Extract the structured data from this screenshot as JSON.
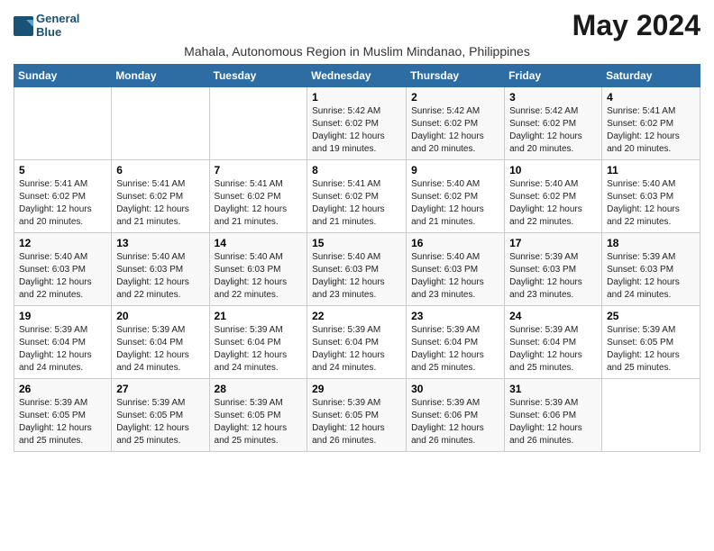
{
  "logo": {
    "line1": "General",
    "line2": "Blue"
  },
  "title": "May 2024",
  "subtitle": "Mahala, Autonomous Region in Muslim Mindanao, Philippines",
  "days_of_week": [
    "Sunday",
    "Monday",
    "Tuesday",
    "Wednesday",
    "Thursday",
    "Friday",
    "Saturday"
  ],
  "weeks": [
    [
      {
        "num": "",
        "info": ""
      },
      {
        "num": "",
        "info": ""
      },
      {
        "num": "",
        "info": ""
      },
      {
        "num": "1",
        "info": "Sunrise: 5:42 AM\nSunset: 6:02 PM\nDaylight: 12 hours\nand 19 minutes."
      },
      {
        "num": "2",
        "info": "Sunrise: 5:42 AM\nSunset: 6:02 PM\nDaylight: 12 hours\nand 20 minutes."
      },
      {
        "num": "3",
        "info": "Sunrise: 5:42 AM\nSunset: 6:02 PM\nDaylight: 12 hours\nand 20 minutes."
      },
      {
        "num": "4",
        "info": "Sunrise: 5:41 AM\nSunset: 6:02 PM\nDaylight: 12 hours\nand 20 minutes."
      }
    ],
    [
      {
        "num": "5",
        "info": "Sunrise: 5:41 AM\nSunset: 6:02 PM\nDaylight: 12 hours\nand 20 minutes."
      },
      {
        "num": "6",
        "info": "Sunrise: 5:41 AM\nSunset: 6:02 PM\nDaylight: 12 hours\nand 21 minutes."
      },
      {
        "num": "7",
        "info": "Sunrise: 5:41 AM\nSunset: 6:02 PM\nDaylight: 12 hours\nand 21 minutes."
      },
      {
        "num": "8",
        "info": "Sunrise: 5:41 AM\nSunset: 6:02 PM\nDaylight: 12 hours\nand 21 minutes."
      },
      {
        "num": "9",
        "info": "Sunrise: 5:40 AM\nSunset: 6:02 PM\nDaylight: 12 hours\nand 21 minutes."
      },
      {
        "num": "10",
        "info": "Sunrise: 5:40 AM\nSunset: 6:02 PM\nDaylight: 12 hours\nand 22 minutes."
      },
      {
        "num": "11",
        "info": "Sunrise: 5:40 AM\nSunset: 6:03 PM\nDaylight: 12 hours\nand 22 minutes."
      }
    ],
    [
      {
        "num": "12",
        "info": "Sunrise: 5:40 AM\nSunset: 6:03 PM\nDaylight: 12 hours\nand 22 minutes."
      },
      {
        "num": "13",
        "info": "Sunrise: 5:40 AM\nSunset: 6:03 PM\nDaylight: 12 hours\nand 22 minutes."
      },
      {
        "num": "14",
        "info": "Sunrise: 5:40 AM\nSunset: 6:03 PM\nDaylight: 12 hours\nand 22 minutes."
      },
      {
        "num": "15",
        "info": "Sunrise: 5:40 AM\nSunset: 6:03 PM\nDaylight: 12 hours\nand 23 minutes."
      },
      {
        "num": "16",
        "info": "Sunrise: 5:40 AM\nSunset: 6:03 PM\nDaylight: 12 hours\nand 23 minutes."
      },
      {
        "num": "17",
        "info": "Sunrise: 5:39 AM\nSunset: 6:03 PM\nDaylight: 12 hours\nand 23 minutes."
      },
      {
        "num": "18",
        "info": "Sunrise: 5:39 AM\nSunset: 6:03 PM\nDaylight: 12 hours\nand 24 minutes."
      }
    ],
    [
      {
        "num": "19",
        "info": "Sunrise: 5:39 AM\nSunset: 6:04 PM\nDaylight: 12 hours\nand 24 minutes."
      },
      {
        "num": "20",
        "info": "Sunrise: 5:39 AM\nSunset: 6:04 PM\nDaylight: 12 hours\nand 24 minutes."
      },
      {
        "num": "21",
        "info": "Sunrise: 5:39 AM\nSunset: 6:04 PM\nDaylight: 12 hours\nand 24 minutes."
      },
      {
        "num": "22",
        "info": "Sunrise: 5:39 AM\nSunset: 6:04 PM\nDaylight: 12 hours\nand 24 minutes."
      },
      {
        "num": "23",
        "info": "Sunrise: 5:39 AM\nSunset: 6:04 PM\nDaylight: 12 hours\nand 25 minutes."
      },
      {
        "num": "24",
        "info": "Sunrise: 5:39 AM\nSunset: 6:04 PM\nDaylight: 12 hours\nand 25 minutes."
      },
      {
        "num": "25",
        "info": "Sunrise: 5:39 AM\nSunset: 6:05 PM\nDaylight: 12 hours\nand 25 minutes."
      }
    ],
    [
      {
        "num": "26",
        "info": "Sunrise: 5:39 AM\nSunset: 6:05 PM\nDaylight: 12 hours\nand 25 minutes."
      },
      {
        "num": "27",
        "info": "Sunrise: 5:39 AM\nSunset: 6:05 PM\nDaylight: 12 hours\nand 25 minutes."
      },
      {
        "num": "28",
        "info": "Sunrise: 5:39 AM\nSunset: 6:05 PM\nDaylight: 12 hours\nand 25 minutes."
      },
      {
        "num": "29",
        "info": "Sunrise: 5:39 AM\nSunset: 6:05 PM\nDaylight: 12 hours\nand 26 minutes."
      },
      {
        "num": "30",
        "info": "Sunrise: 5:39 AM\nSunset: 6:06 PM\nDaylight: 12 hours\nand 26 minutes."
      },
      {
        "num": "31",
        "info": "Sunrise: 5:39 AM\nSunset: 6:06 PM\nDaylight: 12 hours\nand 26 minutes."
      },
      {
        "num": "",
        "info": ""
      }
    ]
  ]
}
